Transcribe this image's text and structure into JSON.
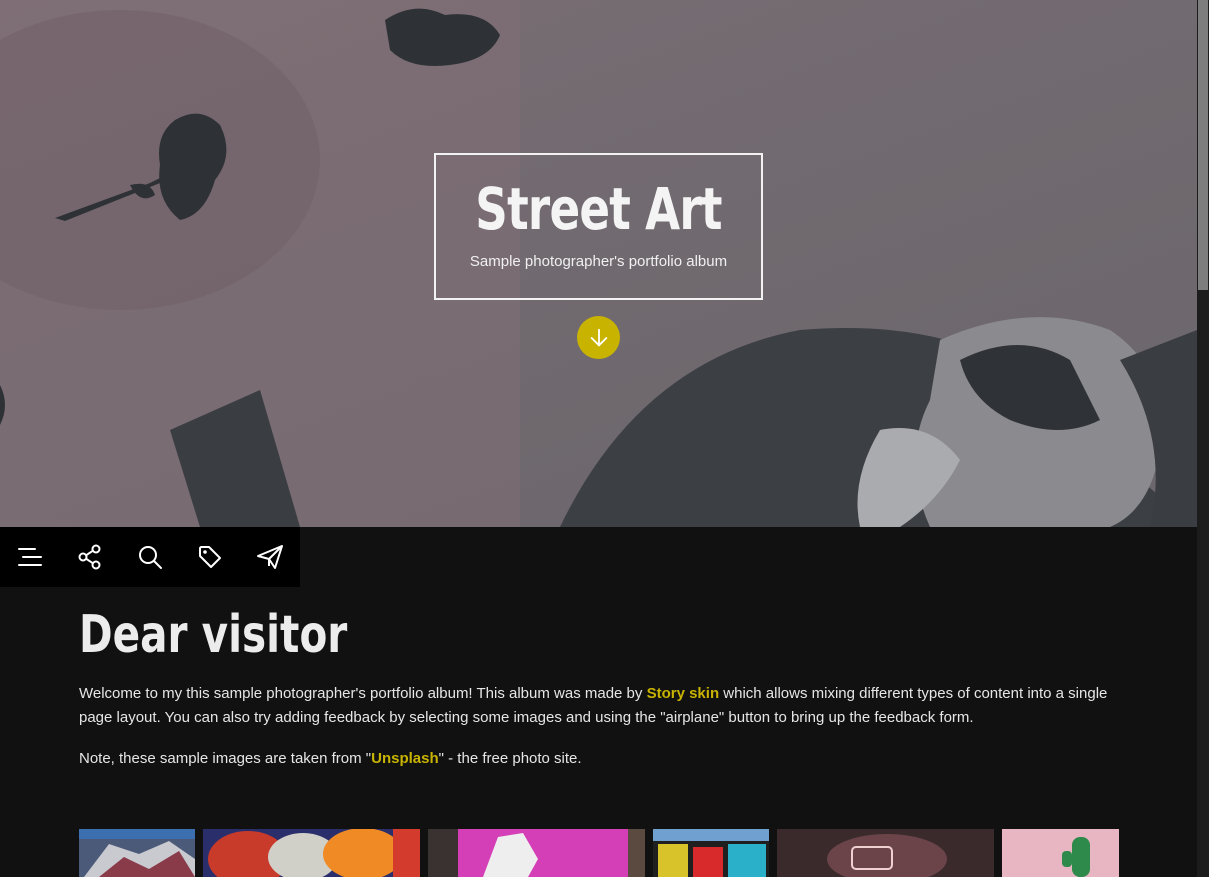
{
  "hero": {
    "title": "Street Art",
    "subtitle": "Sample photographer's portfolio album",
    "scroll_down_icon": "arrow-down-icon"
  },
  "toolbar": {
    "items": [
      {
        "icon": "menu-icon"
      },
      {
        "icon": "share-icon"
      },
      {
        "icon": "search-icon"
      },
      {
        "icon": "tag-icon"
      },
      {
        "icon": "send-feedback-icon"
      }
    ]
  },
  "intro": {
    "heading": "Dear visitor",
    "p1_before": "Welcome to my this sample photographer's portfolio album! This album was made by ",
    "p1_link": "Story skin",
    "p1_after": " which allows mixing different types of content into a single page layout. You can also try adding feedback by selecting some images and using the \"airplane\" button to bring up the feedback form.",
    "p2_before": "Note, these sample images are taken from \"",
    "p2_link": "Unsplash",
    "p2_after": "\" - the free photo site."
  },
  "colors": {
    "accent": "#c8b400",
    "background": "#111111",
    "toolbar": "#000000"
  }
}
